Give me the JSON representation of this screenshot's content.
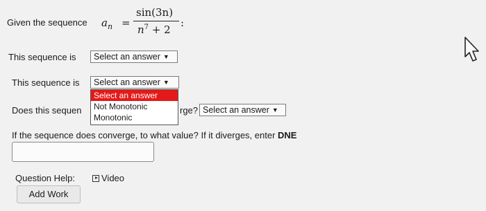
{
  "question": {
    "given_label": "Given the sequence",
    "sequence_symbol": "a",
    "sequence_subscript": "n",
    "equals": "=",
    "numerator": "sin(3n)",
    "denominator_base": "n",
    "denominator_exp": "7",
    "denominator_rest": " + 2",
    "trailing_colon": ":"
  },
  "row1": {
    "label": "This sequence is",
    "select_value": "Select an answer"
  },
  "row2": {
    "label": "This sequence is",
    "select_value": "Select an answer",
    "dropdown_options": [
      "Select an answer",
      "Not Monotonic",
      "Monotonic"
    ],
    "highlighted_option": "Select an answer"
  },
  "row3": {
    "label_left": "Does this sequen",
    "label_right": "rge?",
    "select_value": "Select an answer"
  },
  "row4": {
    "label": "If the sequence does converge, to what value? If it diverges, enter",
    "label_bold": "DNE",
    "input_value": ""
  },
  "help": {
    "label": "Question Help:",
    "video_label": "Video"
  },
  "add_work_label": "Add Work",
  "colors": {
    "highlight": "#e41a1a",
    "background": "#f1f1f1"
  },
  "icons": {
    "chevron": "chevron-down-icon",
    "video": "video-icon",
    "cursor": "mouse-cursor-icon"
  }
}
